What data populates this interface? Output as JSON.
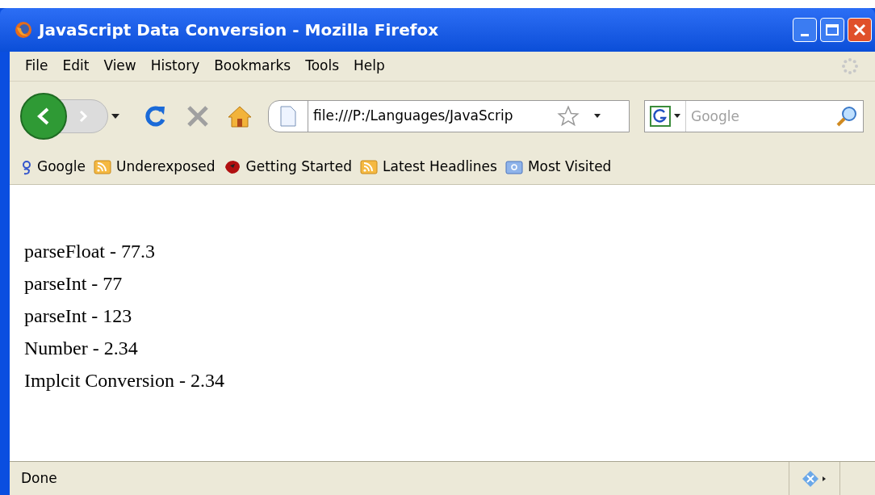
{
  "window": {
    "title": "JavaScript Data Conversion - Mozilla Firefox"
  },
  "menu": [
    "File",
    "Edit",
    "View",
    "History",
    "Bookmarks",
    "Tools",
    "Help"
  ],
  "address": {
    "value": "file:///P:/Languages/JavaScrip"
  },
  "search": {
    "placeholder": "Google"
  },
  "bookmarks": [
    {
      "kind": "google",
      "label": "Google"
    },
    {
      "kind": "feed",
      "label": "Underexposed"
    },
    {
      "kind": "started",
      "label": "Getting Started"
    },
    {
      "kind": "feed",
      "label": "Latest Headlines"
    },
    {
      "kind": "folder",
      "label": "Most Visited"
    }
  ],
  "content": [
    "parseFloat - 77.3",
    "parseInt - 77",
    "parseInt - 123",
    "Number - 2.34",
    "Implcit Conversion - 2.34"
  ],
  "status_bar": {
    "text": "Done"
  }
}
